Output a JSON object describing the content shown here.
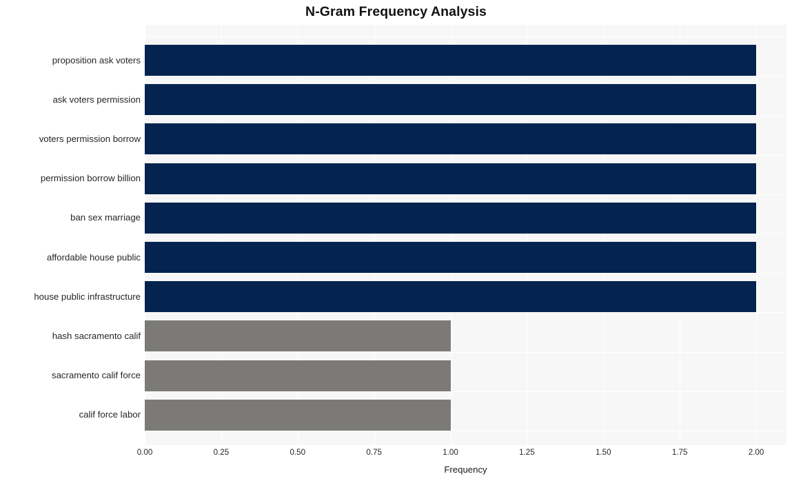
{
  "chart_data": {
    "type": "bar",
    "orientation": "horizontal",
    "title": "N-Gram Frequency Analysis",
    "xlabel": "Frequency",
    "ylabel": "",
    "xlim": [
      0,
      2
    ],
    "xticks": [
      "0.00",
      "0.25",
      "0.50",
      "0.75",
      "1.00",
      "1.25",
      "1.50",
      "1.75",
      "2.00"
    ],
    "xtick_values": [
      0,
      0.25,
      0.5,
      0.75,
      1,
      1.25,
      1.5,
      1.75,
      2
    ],
    "grid": true,
    "legend": "none",
    "categories": [
      "proposition ask voters",
      "ask voters permission",
      "voters permission borrow",
      "permission borrow billion",
      "ban sex marriage",
      "affordable house public",
      "house public infrastructure",
      "hash sacramento calif",
      "sacramento calif force",
      "calif force labor"
    ],
    "values": [
      2,
      2,
      2,
      2,
      2,
      2,
      2,
      1,
      1,
      1
    ],
    "bar_colors": [
      "#04244f",
      "#04244f",
      "#04244f",
      "#04244f",
      "#04244f",
      "#04244f",
      "#04244f",
      "#7b7a78",
      "#7b7a78",
      "#7b7a78"
    ],
    "colors": {
      "high": "#04244f",
      "low": "#7b7a78",
      "plot_background": "#f7f7f7",
      "grid": "#ffffff",
      "figure_background": "#ffffff",
      "text": "#262626"
    }
  }
}
